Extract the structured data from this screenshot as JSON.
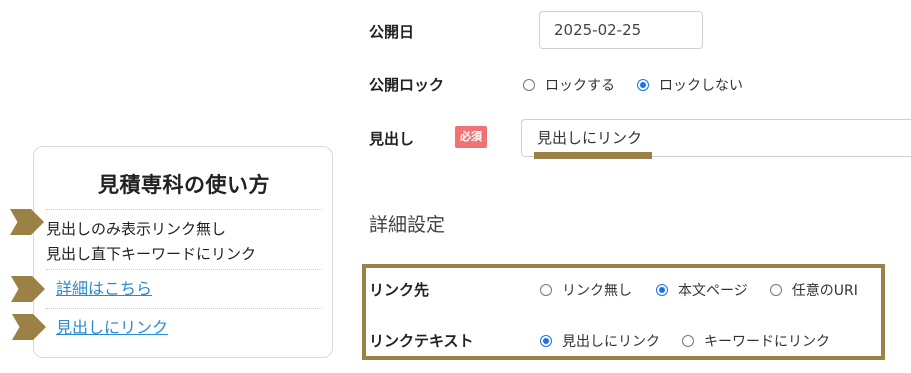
{
  "colors": {
    "accent": "#9c8146",
    "required_badge": "#f07272",
    "link": "#2a8bd0",
    "radio_selected": "#1a73e8"
  },
  "preview_card": {
    "title": "見積専科の使い方",
    "items": [
      {
        "text": "見出しのみ表示リンク無し",
        "is_link": false,
        "arrow": true
      },
      {
        "text": "見出し直下キーワードにリンク",
        "is_link": false,
        "arrow": false
      },
      {
        "text": "詳細はこちら",
        "is_link": true,
        "arrow": true
      },
      {
        "text": "見出しにリンク",
        "is_link": true,
        "arrow": true
      }
    ]
  },
  "form": {
    "publish_date": {
      "label": "公開日",
      "value": "2025-02-25"
    },
    "publish_lock": {
      "label": "公開ロック",
      "options": [
        {
          "label": "ロックする",
          "checked": false
        },
        {
          "label": "ロックしない",
          "checked": true
        }
      ]
    },
    "heading": {
      "label": "見出し",
      "required_badge": "必須",
      "value": "見出しにリンク"
    },
    "details_title": "詳細設定",
    "link_target": {
      "label": "リンク先",
      "options": [
        {
          "label": "リンク無し",
          "checked": false
        },
        {
          "label": "本文ページ",
          "checked": true
        },
        {
          "label": "任意のURI",
          "checked": false
        }
      ]
    },
    "link_text": {
      "label": "リンクテキスト",
      "options": [
        {
          "label": "見出しにリンク",
          "checked": true
        },
        {
          "label": "キーワードにリンク",
          "checked": false
        }
      ]
    }
  }
}
